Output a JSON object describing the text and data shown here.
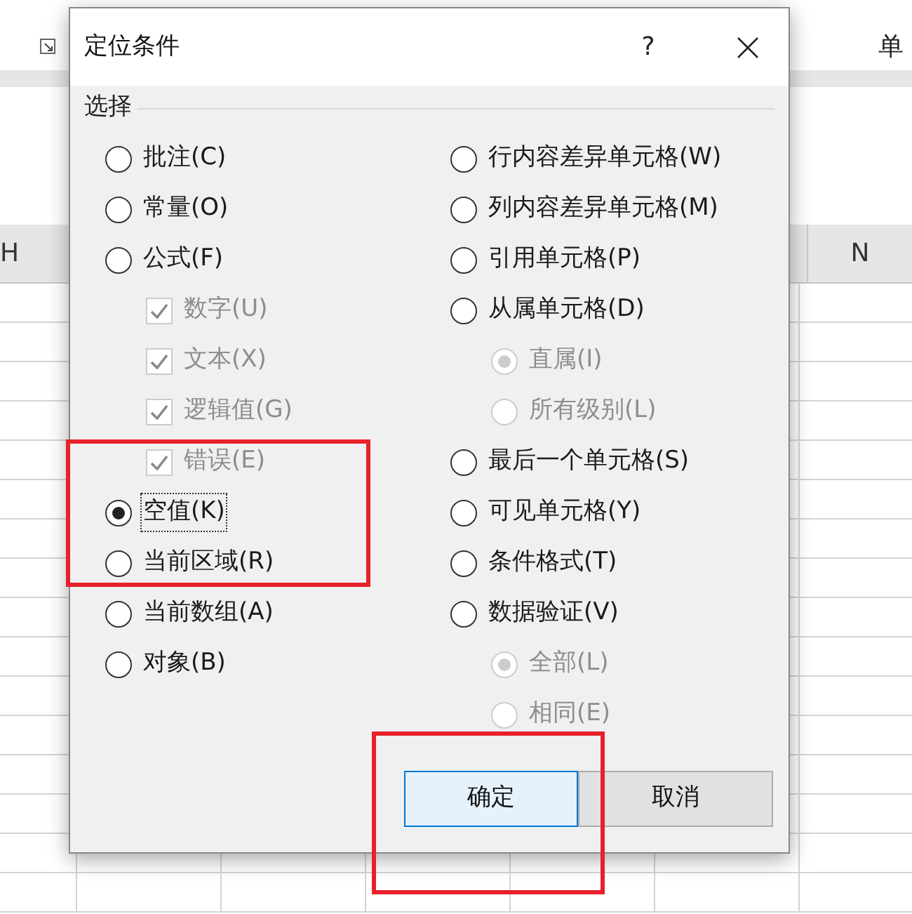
{
  "sheet": {
    "ribbon_label": "单",
    "column_headers": [
      {
        "label": "H"
      },
      {
        "label": "N"
      }
    ]
  },
  "dialog": {
    "title": "定位条件",
    "help": "?",
    "group_label": "选择",
    "left": [
      {
        "kind": "radio",
        "label": "批注(C)",
        "selected": false,
        "disabled": false
      },
      {
        "kind": "radio",
        "label": "常量(O)",
        "selected": false,
        "disabled": false
      },
      {
        "kind": "radio",
        "label": "公式(F)",
        "selected": false,
        "disabled": false,
        "children": [
          {
            "kind": "checkbox",
            "label": "数字(U)",
            "checked": true,
            "disabled": true
          },
          {
            "kind": "checkbox",
            "label": "文本(X)",
            "checked": true,
            "disabled": true
          },
          {
            "kind": "checkbox",
            "label": "逻辑值(G)",
            "checked": true,
            "disabled": true
          },
          {
            "kind": "checkbox",
            "label": "错误(E)",
            "checked": true,
            "disabled": true
          }
        ]
      },
      {
        "kind": "radio",
        "label": "空值(K)",
        "selected": true,
        "disabled": false,
        "focused": true
      },
      {
        "kind": "radio",
        "label": "当前区域(R)",
        "selected": false,
        "disabled": false
      },
      {
        "kind": "radio",
        "label": "当前数组(A)",
        "selected": false,
        "disabled": false
      },
      {
        "kind": "radio",
        "label": "对象(B)",
        "selected": false,
        "disabled": false
      }
    ],
    "right": [
      {
        "kind": "radio",
        "label": "行内容差异单元格(W)",
        "selected": false,
        "disabled": false
      },
      {
        "kind": "radio",
        "label": "列内容差异单元格(M)",
        "selected": false,
        "disabled": false
      },
      {
        "kind": "radio",
        "label": "引用单元格(P)",
        "selected": false,
        "disabled": false
      },
      {
        "kind": "radio",
        "label": "从属单元格(D)",
        "selected": false,
        "disabled": false,
        "children": [
          {
            "kind": "radio",
            "label": "直属(I)",
            "selected": true,
            "disabled": true
          },
          {
            "kind": "radio",
            "label": "所有级别(L)",
            "selected": false,
            "disabled": true
          }
        ]
      },
      {
        "kind": "radio",
        "label": "最后一个单元格(S)",
        "selected": false,
        "disabled": false
      },
      {
        "kind": "radio",
        "label": "可见单元格(Y)",
        "selected": false,
        "disabled": false
      },
      {
        "kind": "radio",
        "label": "条件格式(T)",
        "selected": false,
        "disabled": false
      },
      {
        "kind": "radio",
        "label": "数据验证(V)",
        "selected": false,
        "disabled": false,
        "children": [
          {
            "kind": "radio",
            "label": "全部(L)",
            "selected": true,
            "disabled": true
          },
          {
            "kind": "radio",
            "label": "相同(E)",
            "selected": false,
            "disabled": true
          }
        ]
      }
    ],
    "buttons": [
      {
        "label": "确定",
        "default": true
      },
      {
        "label": "取消",
        "default": false
      }
    ]
  }
}
